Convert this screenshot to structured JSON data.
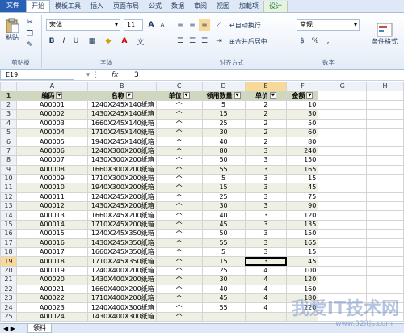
{
  "ribbon_tabs": [
    "文件",
    "开始",
    "模板工具",
    "插入",
    "页面布局",
    "公式",
    "数据",
    "审阅",
    "视图",
    "加载项",
    "设计"
  ],
  "clipboard": {
    "paste": "粘贴",
    "group": "剪贴板"
  },
  "font": {
    "name": "宋体",
    "size": "11",
    "group": "字体",
    "bold": "B",
    "italic": "I",
    "underline": "U",
    "grow": "A",
    "shrink": "A"
  },
  "alignment": {
    "wrap": "自动换行",
    "merge": "合并后居中",
    "group": "对齐方式"
  },
  "number": {
    "format": "常规",
    "group": "数字",
    "currency": "$",
    "percent": "%",
    "comma": ","
  },
  "styles": {
    "conditional": "条件格式"
  },
  "formula_bar": {
    "name_box": "E19",
    "fx": "fx",
    "value": "3"
  },
  "columns": [
    "A",
    "B",
    "C",
    "D",
    "E",
    "F",
    "G",
    "H"
  ],
  "headers": [
    "编码",
    "名称",
    "单位",
    "领用数量",
    "单价",
    "金额"
  ],
  "rows": [
    [
      "A00001",
      "1240X245X140纸箱",
      "个",
      "5",
      "2",
      "10"
    ],
    [
      "A00002",
      "1430X245X140纸箱",
      "个",
      "15",
      "2",
      "30"
    ],
    [
      "A00003",
      "1660X245X140纸箱",
      "个",
      "25",
      "2",
      "50"
    ],
    [
      "A00004",
      "1710X245X140纸箱",
      "个",
      "30",
      "2",
      "60"
    ],
    [
      "A00005",
      "1940X245X140纸箱",
      "个",
      "40",
      "2",
      "80"
    ],
    [
      "A00006",
      "1240X300X200纸箱",
      "个",
      "80",
      "3",
      "240"
    ],
    [
      "A00007",
      "1430X300X200纸箱",
      "个",
      "50",
      "3",
      "150"
    ],
    [
      "A00008",
      "1660X300X200纸箱",
      "个",
      "55",
      "3",
      "165"
    ],
    [
      "A00009",
      "1710X300X200纸箱",
      "个",
      "5",
      "3",
      "15"
    ],
    [
      "A00010",
      "1940X300X200纸箱",
      "个",
      "15",
      "3",
      "45"
    ],
    [
      "A00011",
      "1240X245X200纸箱",
      "个",
      "25",
      "3",
      "75"
    ],
    [
      "A00012",
      "1430X245X200纸箱",
      "个",
      "30",
      "3",
      "90"
    ],
    [
      "A00013",
      "1660X245X200纸箱",
      "个",
      "40",
      "3",
      "120"
    ],
    [
      "A00014",
      "1710X245X200纸箱",
      "个",
      "45",
      "3",
      "135"
    ],
    [
      "A00015",
      "1240X245X350纸箱",
      "个",
      "50",
      "3",
      "150"
    ],
    [
      "A00016",
      "1430X245X350纸箱",
      "个",
      "55",
      "3",
      "165"
    ],
    [
      "A00017",
      "1660X245X350纸箱",
      "个",
      "5",
      "3",
      "15"
    ],
    [
      "A00018",
      "1710X245X350纸箱",
      "个",
      "15",
      "3",
      "45"
    ],
    [
      "A00019",
      "1240X400X200纸箱",
      "个",
      "25",
      "4",
      "100"
    ],
    [
      "A00020",
      "1430X400X200纸箱",
      "个",
      "30",
      "4",
      "120"
    ],
    [
      "A00021",
      "1660X400X200纸箱",
      "个",
      "40",
      "4",
      "160"
    ],
    [
      "A00022",
      "1710X400X200纸箱",
      "个",
      "45",
      "4",
      "180"
    ],
    [
      "A00023",
      "1240X400X300纸箱",
      "个",
      "55",
      "4",
      "220"
    ],
    [
      "A00024",
      "1430X400X300纸箱",
      "个",
      "",
      "",
      ""
    ]
  ],
  "sheet_tab": "领料",
  "watermark": "我爱IT技术网",
  "watermark_sub": "www.52itjs.com",
  "colors": {
    "file_tab": "#2a5fb6",
    "header_fill": "#cfd8bf",
    "band_fill": "#eef0e4",
    "selection": "#f9d99a"
  }
}
